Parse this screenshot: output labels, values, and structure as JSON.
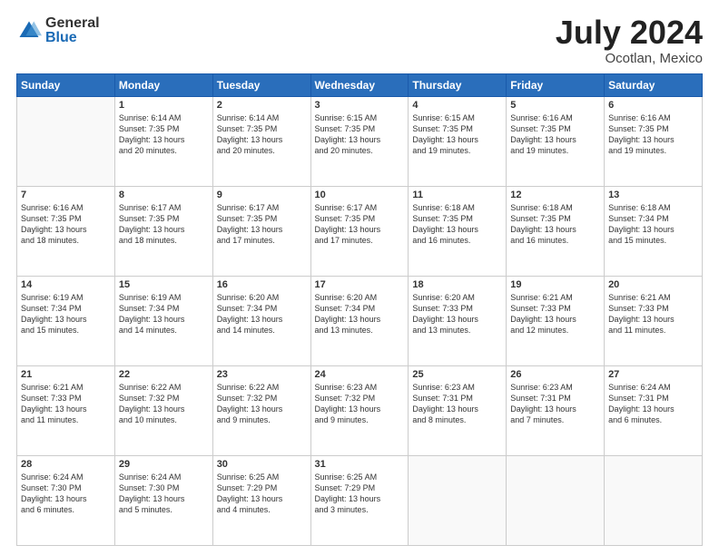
{
  "header": {
    "logo_general": "General",
    "logo_blue": "Blue",
    "title": "July 2024",
    "location": "Ocotlan, Mexico"
  },
  "days_of_week": [
    "Sunday",
    "Monday",
    "Tuesday",
    "Wednesday",
    "Thursday",
    "Friday",
    "Saturday"
  ],
  "weeks": [
    [
      {
        "day": "",
        "info": ""
      },
      {
        "day": "1",
        "info": "Sunrise: 6:14 AM\nSunset: 7:35 PM\nDaylight: 13 hours\nand 20 minutes."
      },
      {
        "day": "2",
        "info": "Sunrise: 6:14 AM\nSunset: 7:35 PM\nDaylight: 13 hours\nand 20 minutes."
      },
      {
        "day": "3",
        "info": "Sunrise: 6:15 AM\nSunset: 7:35 PM\nDaylight: 13 hours\nand 20 minutes."
      },
      {
        "day": "4",
        "info": "Sunrise: 6:15 AM\nSunset: 7:35 PM\nDaylight: 13 hours\nand 19 minutes."
      },
      {
        "day": "5",
        "info": "Sunrise: 6:16 AM\nSunset: 7:35 PM\nDaylight: 13 hours\nand 19 minutes."
      },
      {
        "day": "6",
        "info": "Sunrise: 6:16 AM\nSunset: 7:35 PM\nDaylight: 13 hours\nand 19 minutes."
      }
    ],
    [
      {
        "day": "7",
        "info": "Sunrise: 6:16 AM\nSunset: 7:35 PM\nDaylight: 13 hours\nand 18 minutes."
      },
      {
        "day": "8",
        "info": "Sunrise: 6:17 AM\nSunset: 7:35 PM\nDaylight: 13 hours\nand 18 minutes."
      },
      {
        "day": "9",
        "info": "Sunrise: 6:17 AM\nSunset: 7:35 PM\nDaylight: 13 hours\nand 17 minutes."
      },
      {
        "day": "10",
        "info": "Sunrise: 6:17 AM\nSunset: 7:35 PM\nDaylight: 13 hours\nand 17 minutes."
      },
      {
        "day": "11",
        "info": "Sunrise: 6:18 AM\nSunset: 7:35 PM\nDaylight: 13 hours\nand 16 minutes."
      },
      {
        "day": "12",
        "info": "Sunrise: 6:18 AM\nSunset: 7:35 PM\nDaylight: 13 hours\nand 16 minutes."
      },
      {
        "day": "13",
        "info": "Sunrise: 6:18 AM\nSunset: 7:34 PM\nDaylight: 13 hours\nand 15 minutes."
      }
    ],
    [
      {
        "day": "14",
        "info": "Sunrise: 6:19 AM\nSunset: 7:34 PM\nDaylight: 13 hours\nand 15 minutes."
      },
      {
        "day": "15",
        "info": "Sunrise: 6:19 AM\nSunset: 7:34 PM\nDaylight: 13 hours\nand 14 minutes."
      },
      {
        "day": "16",
        "info": "Sunrise: 6:20 AM\nSunset: 7:34 PM\nDaylight: 13 hours\nand 14 minutes."
      },
      {
        "day": "17",
        "info": "Sunrise: 6:20 AM\nSunset: 7:34 PM\nDaylight: 13 hours\nand 13 minutes."
      },
      {
        "day": "18",
        "info": "Sunrise: 6:20 AM\nSunset: 7:33 PM\nDaylight: 13 hours\nand 13 minutes."
      },
      {
        "day": "19",
        "info": "Sunrise: 6:21 AM\nSunset: 7:33 PM\nDaylight: 13 hours\nand 12 minutes."
      },
      {
        "day": "20",
        "info": "Sunrise: 6:21 AM\nSunset: 7:33 PM\nDaylight: 13 hours\nand 11 minutes."
      }
    ],
    [
      {
        "day": "21",
        "info": "Sunrise: 6:21 AM\nSunset: 7:33 PM\nDaylight: 13 hours\nand 11 minutes."
      },
      {
        "day": "22",
        "info": "Sunrise: 6:22 AM\nSunset: 7:32 PM\nDaylight: 13 hours\nand 10 minutes."
      },
      {
        "day": "23",
        "info": "Sunrise: 6:22 AM\nSunset: 7:32 PM\nDaylight: 13 hours\nand 9 minutes."
      },
      {
        "day": "24",
        "info": "Sunrise: 6:23 AM\nSunset: 7:32 PM\nDaylight: 13 hours\nand 9 minutes."
      },
      {
        "day": "25",
        "info": "Sunrise: 6:23 AM\nSunset: 7:31 PM\nDaylight: 13 hours\nand 8 minutes."
      },
      {
        "day": "26",
        "info": "Sunrise: 6:23 AM\nSunset: 7:31 PM\nDaylight: 13 hours\nand 7 minutes."
      },
      {
        "day": "27",
        "info": "Sunrise: 6:24 AM\nSunset: 7:31 PM\nDaylight: 13 hours\nand 6 minutes."
      }
    ],
    [
      {
        "day": "28",
        "info": "Sunrise: 6:24 AM\nSunset: 7:30 PM\nDaylight: 13 hours\nand 6 minutes."
      },
      {
        "day": "29",
        "info": "Sunrise: 6:24 AM\nSunset: 7:30 PM\nDaylight: 13 hours\nand 5 minutes."
      },
      {
        "day": "30",
        "info": "Sunrise: 6:25 AM\nSunset: 7:29 PM\nDaylight: 13 hours\nand 4 minutes."
      },
      {
        "day": "31",
        "info": "Sunrise: 6:25 AM\nSunset: 7:29 PM\nDaylight: 13 hours\nand 3 minutes."
      },
      {
        "day": "",
        "info": ""
      },
      {
        "day": "",
        "info": ""
      },
      {
        "day": "",
        "info": ""
      }
    ]
  ]
}
